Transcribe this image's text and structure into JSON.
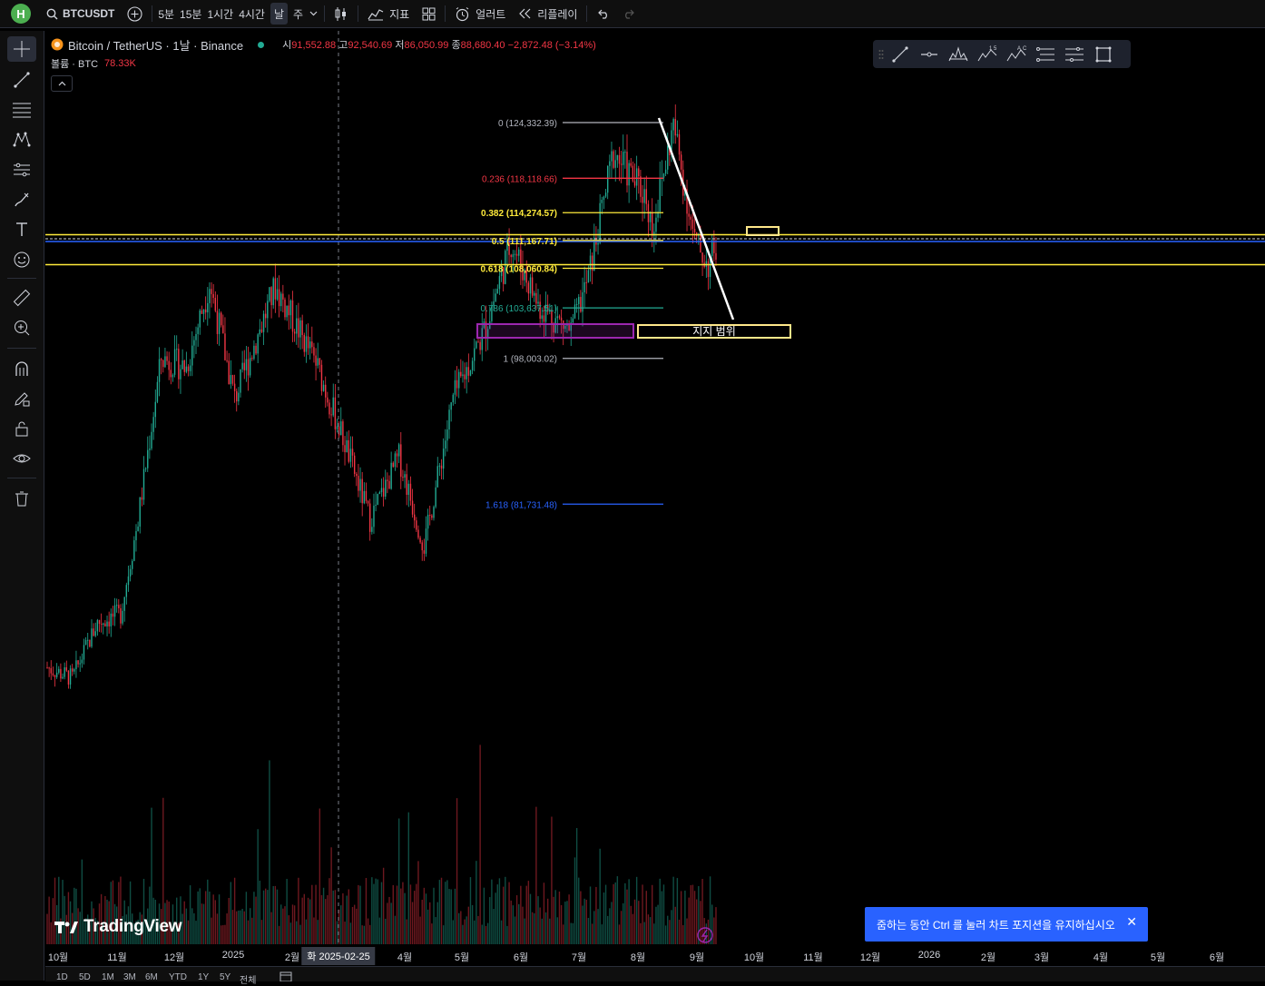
{
  "toolbar": {
    "avatar_letter": "H",
    "symbol": "BTCUSDT",
    "intervals": [
      "5분",
      "15분",
      "1시간",
      "4시간",
      "날",
      "주"
    ],
    "active_interval": "날",
    "indicators_label": "지표",
    "alert_label": "얼러트",
    "replay_label": "리플레이"
  },
  "legend": {
    "title": "Bitcoin / TetherUS · 1날 · Binance",
    "open_label": "시",
    "open": "91,552.88",
    "high_label": "고",
    "high": "92,540.69",
    "low_label": "저",
    "low": "86,050.99",
    "close_label": "종",
    "close": "88,680.40",
    "change": "−2,872.48 (−3.14%)",
    "volume_label": "볼륨 · BTC",
    "volume_value": "78.33K"
  },
  "fib_levels": [
    {
      "label": "0 (124,332.39)",
      "price": 124332.39,
      "color": "#b2b5be",
      "bold": false
    },
    {
      "label": "0.236 (118,118.66)",
      "price": 118118.66,
      "color": "#f23645",
      "bold": false
    },
    {
      "label": "0.382 (114,274.57)",
      "price": 114274.57,
      "color": "#ffeb3b",
      "bold": true
    },
    {
      "label": "0.5 (111,167.71)",
      "price": 111167.71,
      "color": "#ffeb3b",
      "bold": true
    },
    {
      "label": "0.618 (108,060.84)",
      "price": 108060.84,
      "color": "#ffeb3b",
      "bold": true
    },
    {
      "label": "0.786 (103,637.51)",
      "price": 103637.51,
      "color": "#22ab94",
      "bold": false
    },
    {
      "label": "1 (98,003.02)",
      "price": 98003.02,
      "color": "#b2b5be",
      "bold": false
    },
    {
      "label": "1.618 (81,731.48)",
      "price": 81731.48,
      "color": "#2962ff",
      "bold": false
    }
  ],
  "annotations": {
    "support_label": "지지 범위"
  },
  "time_axis": {
    "labels": [
      "10월",
      "11월",
      "12월",
      "2025",
      "2월",
      "4월",
      "5월",
      "6월",
      "7월",
      "8월",
      "9월",
      "10월",
      "11월",
      "12월",
      "2026",
      "2월",
      "3월",
      "4월",
      "5월",
      "6월"
    ],
    "crosshair_label": "화 2025-02-25"
  },
  "bottom_ranges": [
    "1D",
    "5D",
    "1M",
    "3M",
    "6M",
    "YTD",
    "1Y",
    "5Y",
    "전체"
  ],
  "brand": "TradingView",
  "toast": "줌하는 동안 Ctrl 를 눌러 차트 포지션을 유지하십시오",
  "colors": {
    "up": "#22ab94",
    "down": "#f23645",
    "fib_yellow": "#ffeb3b",
    "support_box": "#ffe88a",
    "purple_box": "#9c27b0",
    "blue_line": "#2962ff",
    "accent": "#2962ff"
  },
  "chart_data": {
    "type": "candlestick",
    "symbol": "BTCUSDT",
    "interval": "1D",
    "price_range": [
      55000,
      126000
    ],
    "horizontal_lines": [
      111167.71,
      108060.84,
      110400
    ],
    "trendline": {
      "from_price": 124332.39,
      "to_price": 103000,
      "from_date": "2025-08-14",
      "to_date": "2025-09-05"
    },
    "x_range": [
      "2024-09-24",
      "2026-06-15"
    ],
    "price_path": [
      {
        "date": "2024-09-24",
        "price": 63500
      },
      {
        "date": "2024-10-07",
        "price": 62300
      },
      {
        "date": "2024-10-20",
        "price": 68500
      },
      {
        "date": "2024-11-01",
        "price": 69500
      },
      {
        "date": "2024-11-10",
        "price": 80000
      },
      {
        "date": "2024-11-22",
        "price": 98000
      },
      {
        "date": "2024-12-05",
        "price": 97000
      },
      {
        "date": "2024-12-17",
        "price": 106500
      },
      {
        "date": "2024-12-30",
        "price": 93500
      },
      {
        "date": "2025-01-20",
        "price": 106000
      },
      {
        "date": "2025-02-10",
        "price": 97500
      },
      {
        "date": "2025-02-25",
        "price": 88500
      },
      {
        "date": "2025-03-10",
        "price": 80000
      },
      {
        "date": "2025-03-25",
        "price": 87000
      },
      {
        "date": "2025-04-07",
        "price": 77000
      },
      {
        "date": "2025-04-22",
        "price": 93500
      },
      {
        "date": "2025-05-08",
        "price": 101000
      },
      {
        "date": "2025-05-22",
        "price": 111000
      },
      {
        "date": "2025-06-05",
        "price": 104000
      },
      {
        "date": "2025-06-22",
        "price": 101000
      },
      {
        "date": "2025-07-01",
        "price": 107000
      },
      {
        "date": "2025-07-14",
        "price": 121000
      },
      {
        "date": "2025-07-31",
        "price": 116000
      },
      {
        "date": "2025-08-03",
        "price": 112500
      },
      {
        "date": "2025-08-14",
        "price": 124000
      },
      {
        "date": "2025-08-25",
        "price": 111000
      },
      {
        "date": "2025-09-01",
        "price": 108500
      },
      {
        "date": "2025-09-05",
        "price": 110500
      }
    ]
  }
}
